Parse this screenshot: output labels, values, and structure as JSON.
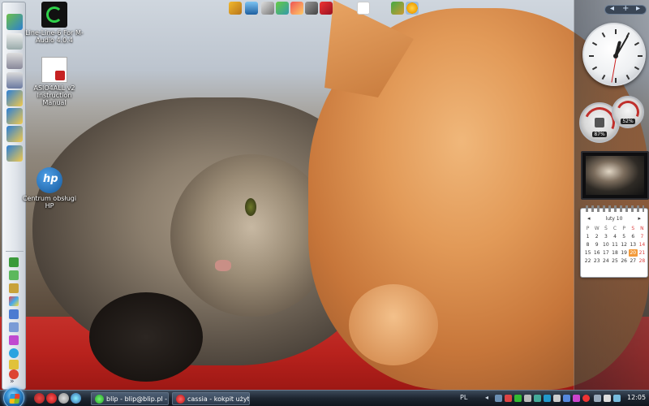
{
  "desktop": {
    "icons": [
      {
        "name": "line-6-icon",
        "label": "Line-Line-6 For M-Audio 4.0.4"
      },
      {
        "name": "pdf-doc-icon",
        "label": "ASIO4ALL v2 Instruction Manual"
      },
      {
        "name": "hp-icon",
        "label": "Centrum obsługi HP"
      }
    ]
  },
  "launcher": {
    "more_label": "»",
    "colors": {
      "bar": "#e6eaef"
    }
  },
  "sidebar": {
    "controls": {
      "add": "+",
      "prev": "◂",
      "next": "▸"
    },
    "cpu_meter": {
      "value": "87%"
    },
    "mem_meter": {
      "value": "52%"
    },
    "calendar": {
      "month_label": "luty 10",
      "weekdays": [
        "P",
        "W",
        "Ś",
        "C",
        "P",
        "S",
        "N"
      ],
      "days": [
        "1",
        "2",
        "3",
        "4",
        "5",
        "6",
        "7",
        "8",
        "9",
        "10",
        "11",
        "12",
        "13",
        "14",
        "15",
        "16",
        "17",
        "18",
        "19",
        "20",
        "21",
        "22",
        "23",
        "24",
        "25",
        "26",
        "27",
        "28"
      ],
      "today": "20"
    }
  },
  "taskbar": {
    "tasks": [
      {
        "label": "blip - blip@blip.pl - ..."
      },
      {
        "label": "cassia - kokpit użytk..."
      }
    ],
    "language": "PL",
    "time": "12:05"
  }
}
